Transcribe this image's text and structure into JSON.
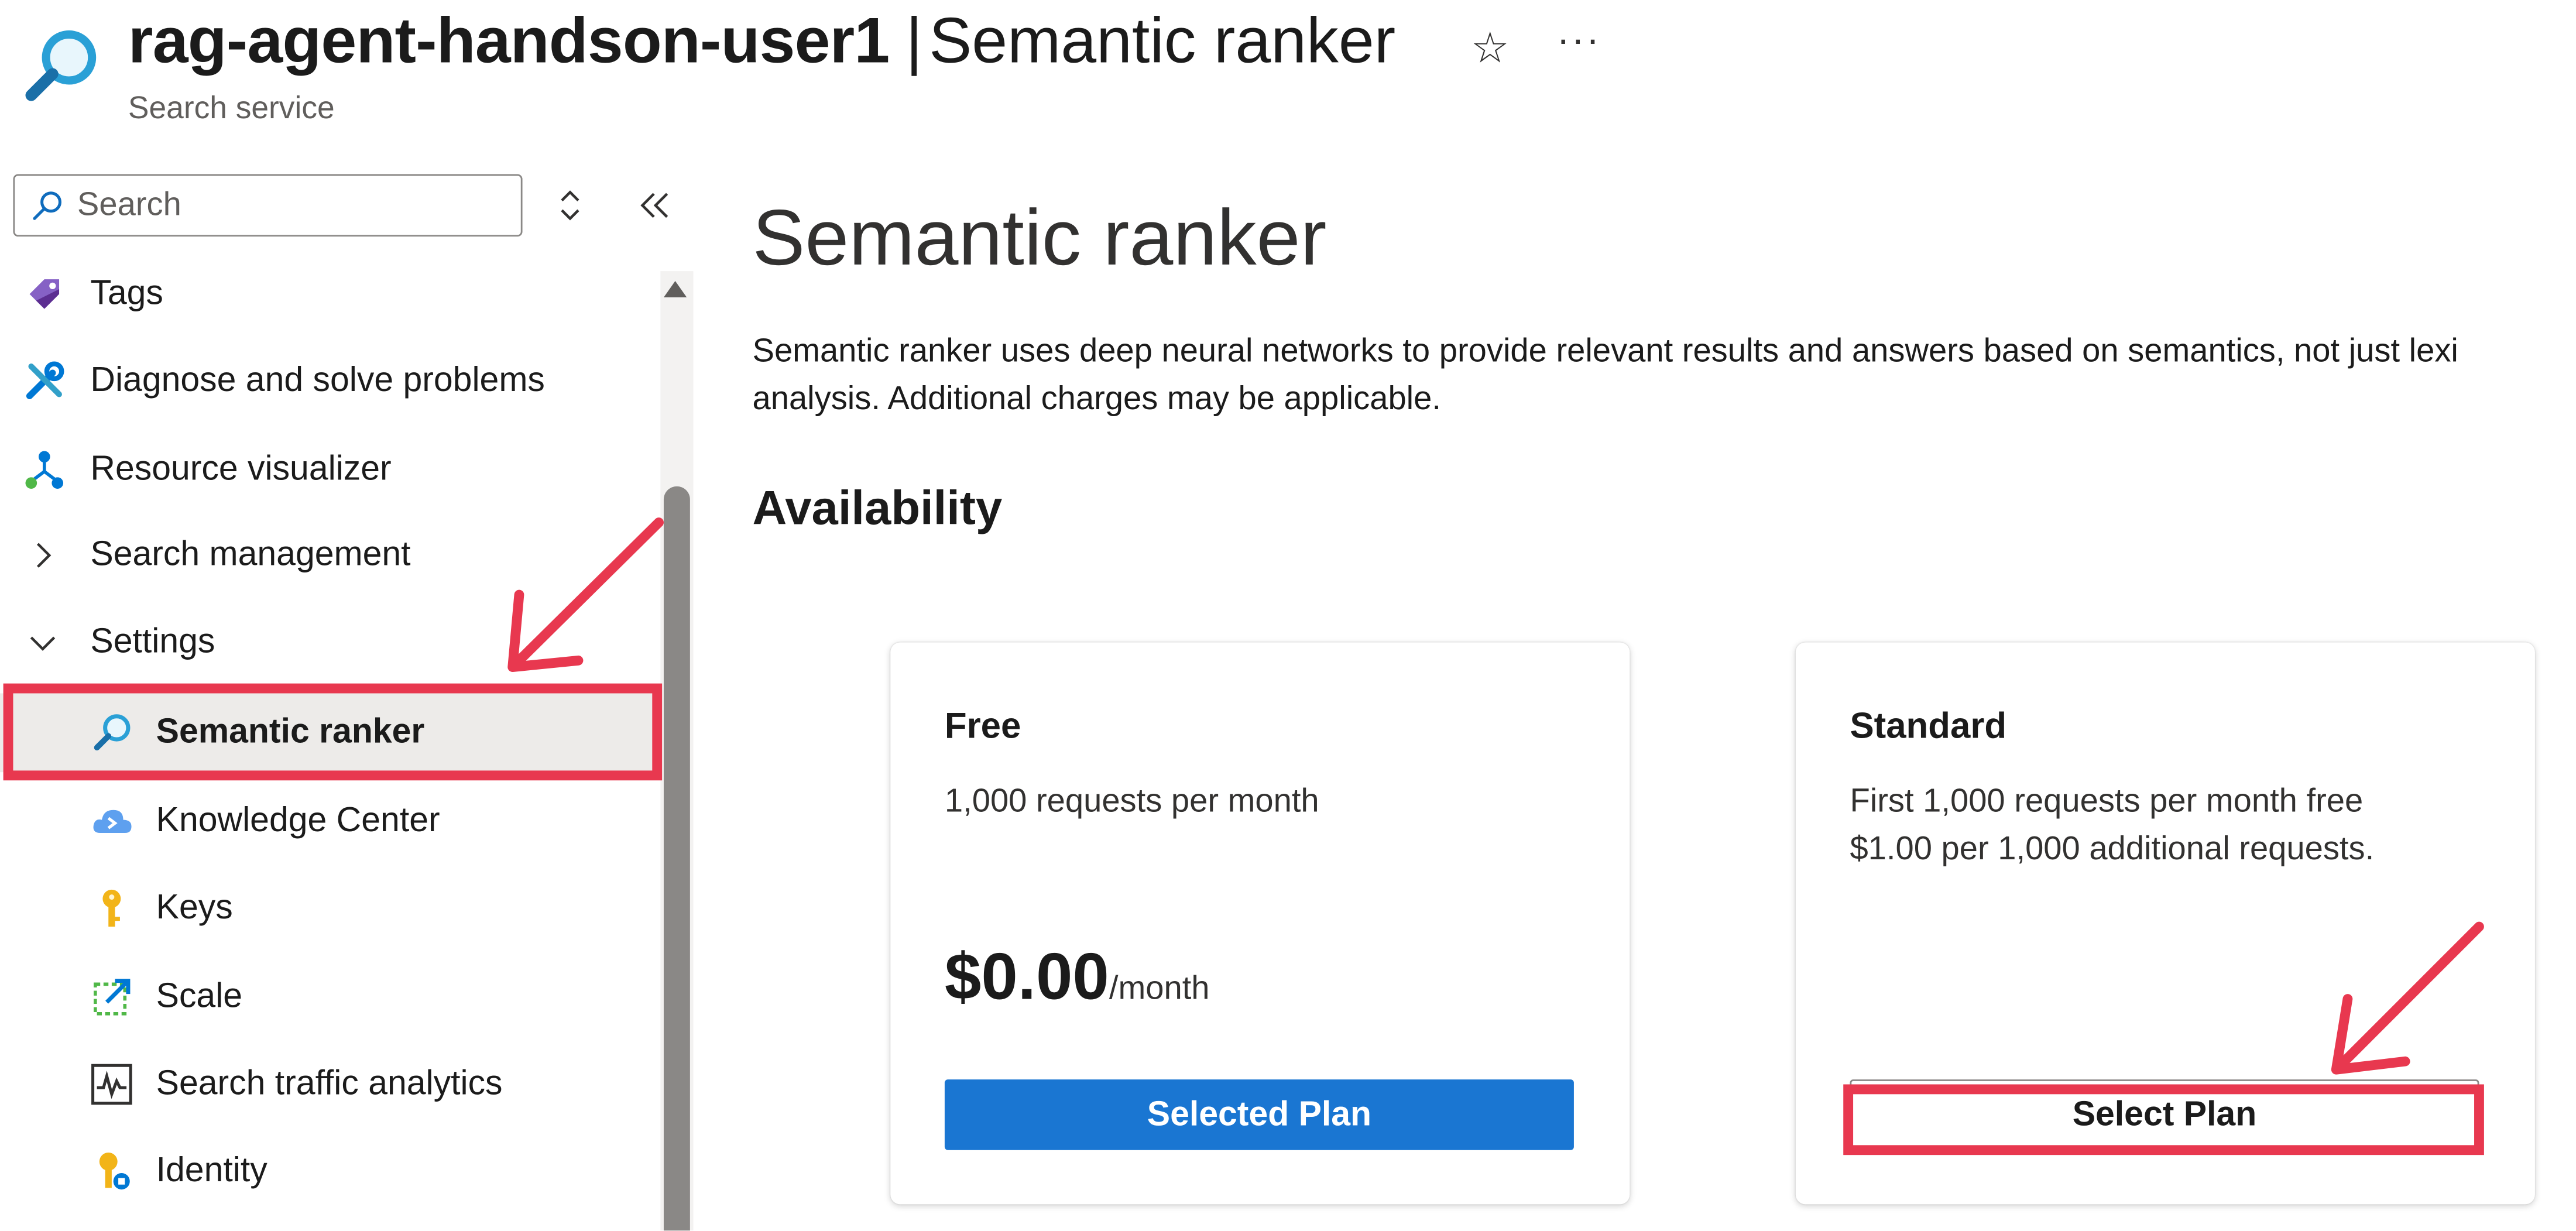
{
  "header": {
    "resource_name": "rag-agent-handson-user1",
    "separator": "|",
    "blade_title": "Semantic ranker",
    "subtitle": "Search service",
    "icons": {
      "service": "search-service-icon",
      "favorite": "star-icon",
      "more": "ellipsis-icon"
    }
  },
  "sidebar": {
    "search_placeholder": "Search",
    "items": [
      {
        "label": "Tags",
        "icon": "tag-icon",
        "level": "top"
      },
      {
        "label": "Diagnose and solve problems",
        "icon": "wrench-icon",
        "level": "top"
      },
      {
        "label": "Resource visualizer",
        "icon": "hierarchy-icon",
        "level": "top"
      },
      {
        "label": "Search management",
        "icon": "chevron-right-icon",
        "level": "group",
        "expanded": false
      },
      {
        "label": "Settings",
        "icon": "chevron-down-icon",
        "level": "group",
        "expanded": true
      },
      {
        "label": "Semantic ranker",
        "icon": "search-icon",
        "level": "sub",
        "selected": true
      },
      {
        "label": "Knowledge Center",
        "icon": "cloud-icon",
        "level": "sub"
      },
      {
        "label": "Keys",
        "icon": "key-icon",
        "level": "sub"
      },
      {
        "label": "Scale",
        "icon": "scale-icon",
        "level": "sub"
      },
      {
        "label": "Search traffic analytics",
        "icon": "pulse-chart-icon",
        "level": "sub"
      },
      {
        "label": "Identity",
        "icon": "identity-key-icon",
        "level": "sub"
      }
    ]
  },
  "main": {
    "title": "Semantic ranker",
    "description_line1": "Semantic ranker uses deep neural networks to provide relevant results and answers based on semantics, not just lexi",
    "description_line2": "analysis. Additional charges may be applicable.",
    "availability_heading": "Availability",
    "plans": [
      {
        "name": "Free",
        "line1": "1,000 requests per month",
        "price": "$0.00",
        "price_unit": "/month",
        "button_label": "Selected Plan"
      },
      {
        "name": "Standard",
        "line1": "First 1,000 requests per month free",
        "line2": "$1.00 per 1,000 additional requests.",
        "button_label": "Select Plan"
      }
    ]
  },
  "colors": {
    "accent_blue": "#1a76d2",
    "annotation_red": "#e8384f",
    "selected_row_bg": "#edebe9"
  }
}
